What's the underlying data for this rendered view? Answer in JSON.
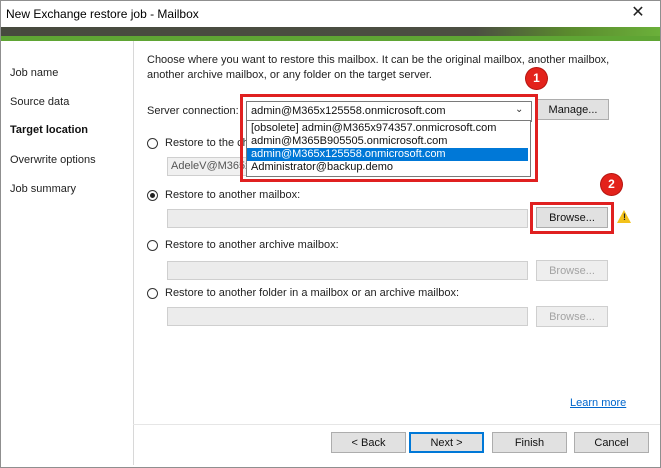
{
  "window": {
    "title": "New Exchange restore job - Mailbox"
  },
  "sidebar": {
    "items": [
      {
        "label": "Job name",
        "active": false
      },
      {
        "label": "Source data",
        "active": false
      },
      {
        "label": "Target location",
        "active": true
      },
      {
        "label": "Overwrite options",
        "active": false
      },
      {
        "label": "Job summary",
        "active": false
      }
    ]
  },
  "main": {
    "description": "Choose where you want to restore this mailbox. It can be the original mailbox, another mailbox, another archive mailbox, or any folder on the target server.",
    "server_connection": {
      "label": "Server connection:",
      "value": "admin@M365x125558.onmicrosoft.com",
      "manage_label": "Manage...",
      "options": [
        "[obsolete] admin@M365x974357.onmicrosoft.com",
        "admin@M365B905505.onmicrosoft.com",
        "admin@M365x125558.onmicrosoft.com",
        "Administrator@backup.demo"
      ],
      "selected_index": 2
    },
    "option_original": {
      "label": "Restore to the ch",
      "field_value": "AdeleV@M365x"
    },
    "option_another_mailbox": {
      "label": "Restore to another mailbox:",
      "browse_label": "Browse...",
      "selected": true
    },
    "option_archive": {
      "label": "Restore to another archive mailbox:",
      "browse_label": "Browse..."
    },
    "option_folder": {
      "label": "Restore to another folder in a mailbox or an archive mailbox:",
      "browse_label": "Browse..."
    },
    "learn_more": "Learn more"
  },
  "annotations": {
    "badge1": "1",
    "badge2": "2",
    "highlight_color": "#e02020"
  },
  "footer": {
    "back_label": "< Back",
    "next_label": "Next >",
    "finish_label": "Finish",
    "cancel_label": "Cancel"
  },
  "colors": {
    "accent_green": "#5fa534",
    "selection_blue": "#0078d7",
    "link_blue": "#0066cc"
  }
}
